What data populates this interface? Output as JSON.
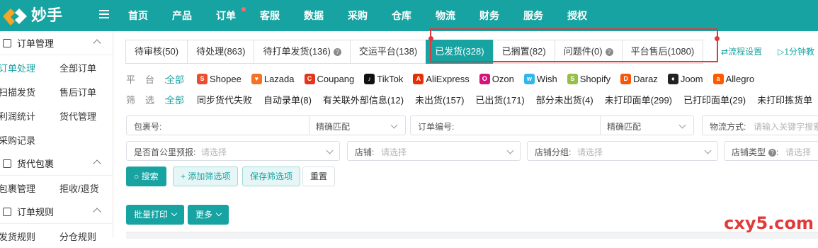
{
  "app": {
    "logo_text": "妙手",
    "accent": "#17a3a1"
  },
  "topnav": [
    {
      "label": "首页"
    },
    {
      "label": "产品"
    },
    {
      "label": "订单",
      "dot": true
    },
    {
      "label": "客服"
    },
    {
      "label": "数据"
    },
    {
      "label": "采购"
    },
    {
      "label": "仓库"
    },
    {
      "label": "物流"
    },
    {
      "label": "财务"
    },
    {
      "label": "服务"
    },
    {
      "label": "授权"
    }
  ],
  "sidebar": {
    "sections": [
      {
        "title": "订单管理",
        "items": [
          [
            "订单处理",
            "全部订单"
          ],
          [
            "扫描发货",
            "售后订单"
          ],
          [
            "利润统计",
            "货代管理"
          ],
          [
            "采购记录"
          ]
        ]
      },
      {
        "title": "货代包裹",
        "items": [
          [
            "包裹管理",
            "拒收/退货"
          ]
        ]
      },
      {
        "title": "订单规则",
        "items": [
          [
            "发货规则",
            "分仓规则"
          ]
        ]
      }
    ],
    "active_item": "订单处理"
  },
  "tabs": [
    {
      "label": "待审核(50)"
    },
    {
      "label": "待处理(863)"
    },
    {
      "label": "待打单发货(136)",
      "help": true
    },
    {
      "label": "交运平台(138)"
    },
    {
      "label": "已发货(328)",
      "active": true
    },
    {
      "label": "已搁置(82)"
    },
    {
      "label": "问题件(0)",
      "help": true
    },
    {
      "label": "平台售后(1080)"
    }
  ],
  "tab_extras": [
    "流程设置",
    "1分钟教"
  ],
  "platform_filter": {
    "label": "平台:",
    "all": "全部",
    "platforms": [
      {
        "name": "Shopee",
        "icon": "shopee-icon",
        "color": "#ee4d2d"
      },
      {
        "name": "Lazada",
        "icon": "lazada-icon",
        "color": "#f57224"
      },
      {
        "name": "Coupang",
        "icon": "coupang-icon",
        "color": "#e5341d"
      },
      {
        "name": "TikTok",
        "icon": "tiktok-icon",
        "color": "#111111"
      },
      {
        "name": "AliExpress",
        "icon": "aliexpress-icon",
        "color": "#e62e04"
      },
      {
        "name": "Ozon",
        "icon": "ozon-icon",
        "color": "#d6137d"
      },
      {
        "name": "Wish",
        "icon": "wish-icon",
        "color": "#2fb7ec"
      },
      {
        "name": "Shopify",
        "icon": "shopify-icon",
        "color": "#95bf47"
      },
      {
        "name": "Daraz",
        "icon": "daraz-icon",
        "color": "#f85606"
      },
      {
        "name": "Joom",
        "icon": "joom-icon",
        "color": "#222222"
      },
      {
        "name": "Allegro",
        "icon": "allegro-icon",
        "color": "#ff5a00"
      }
    ]
  },
  "status_filter": {
    "label": "筛选:",
    "all": "全部",
    "items": [
      "同步货代失败",
      "自动录单(8)",
      "有关联外部信息(12)",
      "未出货(157)",
      "已出货(171)",
      "部分未出货(4)",
      "未打印面单(299)",
      "已打印面单(29)",
      "未打印拣货单"
    ]
  },
  "search": {
    "package_label": "包裹号:",
    "package_match": "精确匹配",
    "order_label": "订单编号:",
    "order_match": "精确匹配",
    "logistics_label": "物流方式:",
    "logistics_placeholder": "请输入关键字搜索",
    "prewarn_label": "是否首公里预报:",
    "prewarn_placeholder": "请选择",
    "shop_label": "店铺:",
    "shop_placeholder": "请选择",
    "shopgroup_label": "店铺分组:",
    "shopgroup_placeholder": "请选择",
    "shoptype_label": "店铺类型",
    "shoptype_placeholder": "请选择"
  },
  "buttons": {
    "search": "搜索",
    "add_filter": "+ 添加筛选项",
    "save_filter": "保存筛选项",
    "reset": "重置",
    "batch_print": "批量打印",
    "more": "更多"
  },
  "watermark": "cxy5.com"
}
